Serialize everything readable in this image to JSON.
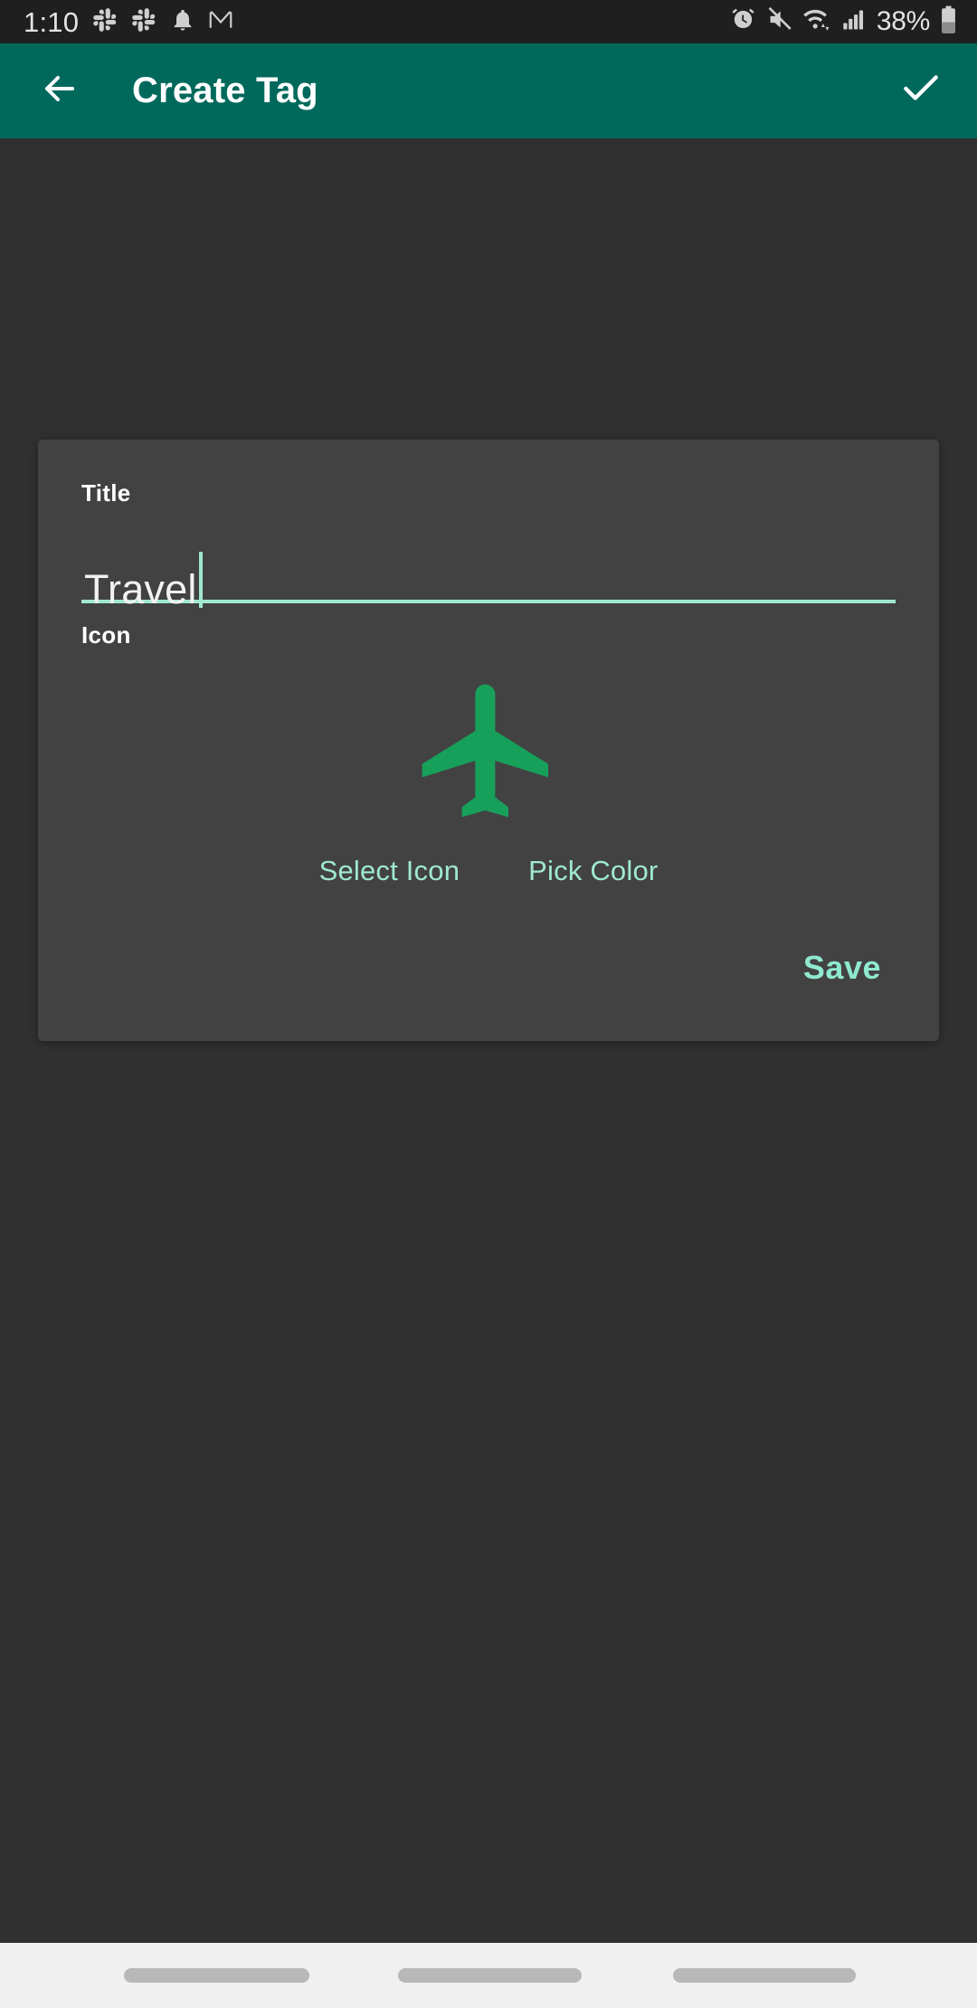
{
  "status_bar": {
    "time": "1:10",
    "battery_percent": "38%",
    "left_icons": [
      "slack-icon",
      "slack-icon",
      "bell-icon",
      "gmail-icon"
    ],
    "right_icons": [
      "alarm-icon",
      "volume-mute-icon",
      "wifi-icon",
      "cellular-signal-icon",
      "battery-icon"
    ],
    "background_color": "#1f1f1f"
  },
  "appbar": {
    "title": "Create Tag",
    "back_icon": "arrow-left-icon",
    "confirm_icon": "check-icon",
    "background_color": "#00695c",
    "text_color": "#ffffff"
  },
  "dialog": {
    "title_label": "Title",
    "title_value": "Travel",
    "title_placeholder": "Title",
    "icon_label": "Icon",
    "icon_name": "airplane-icon",
    "icon_color": "#17a05a",
    "select_icon_label": "Select Icon",
    "pick_color_label": "Pick Color",
    "save_label": "Save",
    "accent_color": "#9fe8cf",
    "surface_color": "#424242"
  },
  "navbar": {
    "background_color": "#f0f0f0",
    "pill_color": "#b8b8b8",
    "items": [
      "back-pill",
      "home-pill",
      "recents-pill"
    ]
  }
}
